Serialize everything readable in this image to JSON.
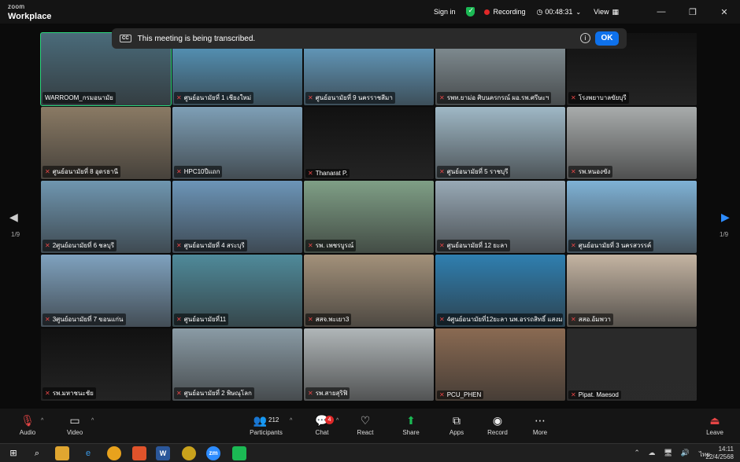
{
  "titlebar": {
    "logo_line1": "zoom",
    "logo_line2": "Workplace",
    "signin": "Sign in",
    "recording": "Recording",
    "time": "00:48:31",
    "view": "View"
  },
  "banner": {
    "cc": "CC",
    "text": "This meeting is being transcribed.",
    "ok": "OK"
  },
  "nav": {
    "page_left": "1/9",
    "page_right": "1/9"
  },
  "tiles": [
    {
      "label": "WARROOM_กรมอนามัย",
      "muted": false,
      "scene": "#4a6b7a",
      "active": true
    },
    {
      "label": "ศูนย์อนามัยที่ 1 เชียงใหม่",
      "muted": true,
      "scene": "#5aa0c8"
    },
    {
      "label": "ศูนย์อนามัยที่ 9 นครราชสีมา",
      "muted": true,
      "scene": "#6aa8cf"
    },
    {
      "label": "รพท.ยาม่อ ศิบนครกรณ์ ผอ.รพ.ศรีษะฯ",
      "muted": true,
      "scene": "#8c9aa0"
    },
    {
      "label": "โรงพยาบาลขัยบุรี",
      "muted": true,
      "scene": "#111111"
    },
    {
      "label": "ศูนย์อนามัยที่ 8 อุดรธานี",
      "muted": true,
      "scene": "#8a7a64"
    },
    {
      "label": "HPC10ปีแถก",
      "muted": true,
      "scene": "#7e9fb6"
    },
    {
      "label": "Thanarat P.",
      "muted": true,
      "scene": "#111111"
    },
    {
      "label": "ศูนย์อนามัยที่ 5 ราชบุรี",
      "muted": true,
      "scene": "#9fb8c6"
    },
    {
      "label": "รพ.หนองขัง",
      "muted": true,
      "scene": "#a8acac"
    },
    {
      "label": "2ศูนย์อนามัยที่ 6 ชลบุรี",
      "muted": true,
      "scene": "#6f96b0"
    },
    {
      "label": "ศูนย์อนามัยที่ 4 สระบุรี",
      "muted": true,
      "scene": "#6c95b8"
    },
    {
      "label": "รพ. เพชรบูรณ์",
      "muted": true,
      "scene": "#7f9f86"
    },
    {
      "label": "ศูนย์อนามัยที่ 12 ยะลา",
      "muted": true,
      "scene": "#98a9b6"
    },
    {
      "label": "ศูนย์อนามัยที่ 3 นครสวรรค์",
      "muted": true,
      "scene": "#7fb2d6"
    },
    {
      "label": "3ศูนย์อนามัยที่ 7 ขอนแก่น",
      "muted": true,
      "scene": "#7fa2bf"
    },
    {
      "label": "ศูนย์อนามัยที่11",
      "muted": true,
      "scene": "#4f8a9a"
    },
    {
      "label": "สสจ.พะเยา3",
      "muted": true,
      "scene": "#a3917a"
    },
    {
      "label": "4ศูนย์อนามัยที่12ยะลา นพ.อรรถสิทธิ์ แสงมณี",
      "muted": true,
      "scene": "#2f7fb0"
    },
    {
      "label": "สสอ.อ้มพวา",
      "muted": true,
      "scene": "#c4b4a2"
    },
    {
      "label": "รพ.มหาชนะชัย",
      "muted": true,
      "scene": "#111111"
    },
    {
      "label": "ศูนย์อนามัยที่ 2 พิษณุโลก",
      "muted": true,
      "scene": "#8a9ba5"
    },
    {
      "label": "รพ.สายสุริฟิ",
      "muted": true,
      "scene": "#b0b6b8"
    },
    {
      "label": "PCU_PHEN",
      "muted": true,
      "scene": "#8a6a52"
    },
    {
      "label": "Pipat. Maesod",
      "muted": true,
      "scene": "#2a2a2a"
    }
  ],
  "toolbar": {
    "audio": "Audio",
    "video": "Video",
    "participants": "Participants",
    "participants_count": "212",
    "chat": "Chat",
    "chat_badge": "4",
    "react": "React",
    "share": "Share",
    "apps": "Apps",
    "record": "Record",
    "more": "More",
    "leave": "Leave"
  },
  "taskbar": {
    "time": "14:11",
    "date": "22/4/2568",
    "lang": "ไทย"
  },
  "colors": {
    "accent": "#0e71eb",
    "active_speaker": "#2bd67b",
    "record": "#e02828",
    "share": "#1bb954"
  }
}
